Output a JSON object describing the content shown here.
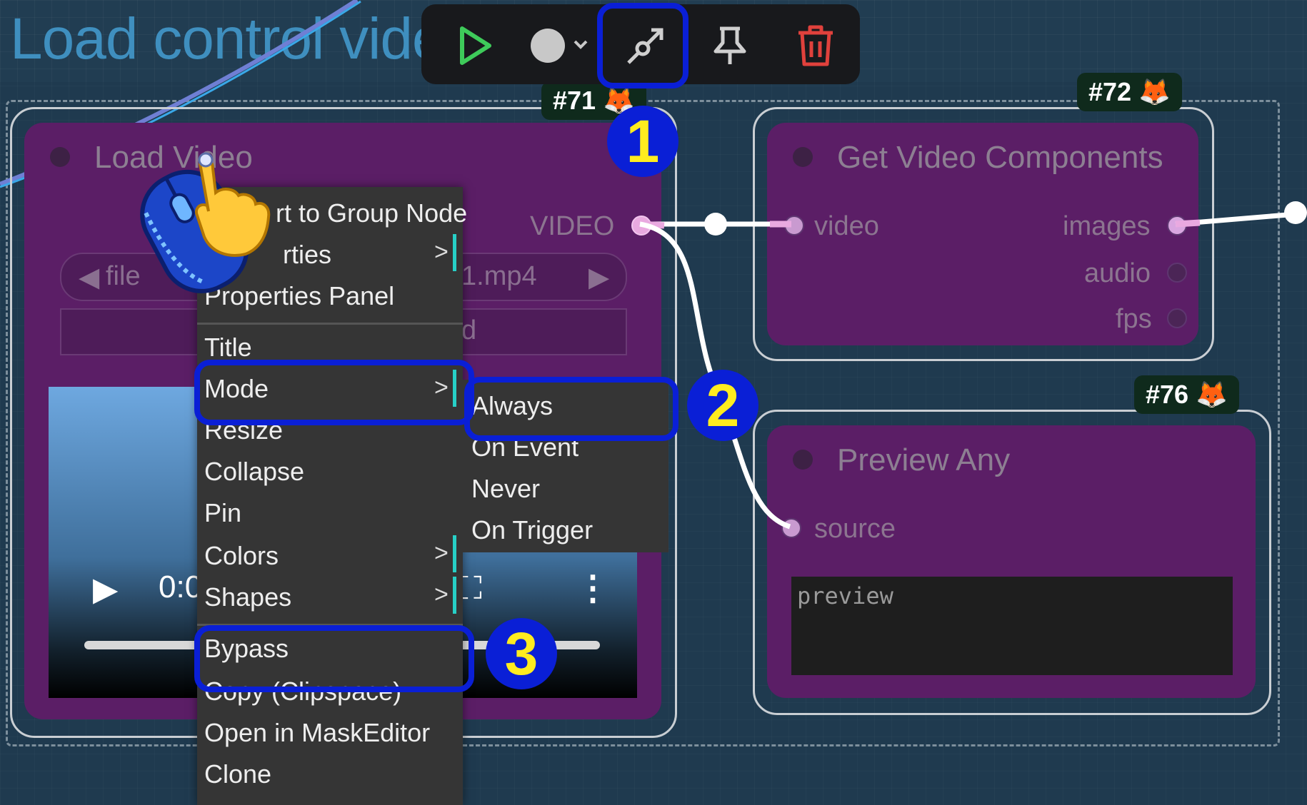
{
  "group": {
    "title": "Load control vide"
  },
  "toolbar": {
    "buttons": [
      {
        "name": "run-icon"
      },
      {
        "name": "color-icon"
      },
      {
        "name": "bypass-icon"
      },
      {
        "name": "pin-icon"
      },
      {
        "name": "delete-icon"
      }
    ]
  },
  "steps": [
    "1",
    "2",
    "3"
  ],
  "nodes": {
    "load_video": {
      "badge": "#71",
      "title": "Load Video",
      "output": "VIDEO",
      "file_prefix": "file",
      "file_value": "1.mp4",
      "second_widget": "d",
      "video_time": "0:0"
    },
    "get_video_components": {
      "badge": "#72",
      "title": "Get Video Components",
      "input": "video",
      "outputs": [
        "images",
        "audio",
        "fps"
      ]
    },
    "preview_any": {
      "badge": "#76",
      "title": "Preview Any",
      "input": "source",
      "preview_placeholder": "preview"
    }
  },
  "context_menu": {
    "items": [
      {
        "label": "rt to Group Node"
      },
      {
        "label": "rties"
      },
      {
        "label": "Properties Panel"
      },
      {
        "label": "Title"
      },
      {
        "label": "Mode"
      },
      {
        "label": "Resize"
      },
      {
        "label": "Collapse"
      },
      {
        "label": "Pin"
      },
      {
        "label": "Colors"
      },
      {
        "label": "Shapes"
      },
      {
        "label": "Bypass"
      },
      {
        "label": "Copy (Clipspace)"
      },
      {
        "label": "Open in MaskEditor"
      },
      {
        "label": "Clone"
      }
    ],
    "submenu_marker": ">"
  },
  "mode_submenu": {
    "items": [
      "Always",
      "On Event",
      "Never",
      "On Trigger"
    ]
  },
  "colors": {
    "highlight": "#0a1fd6",
    "step_text": "#ffec1f",
    "node_body": "#5b1e66",
    "accent_teal": "#27d0c7"
  }
}
